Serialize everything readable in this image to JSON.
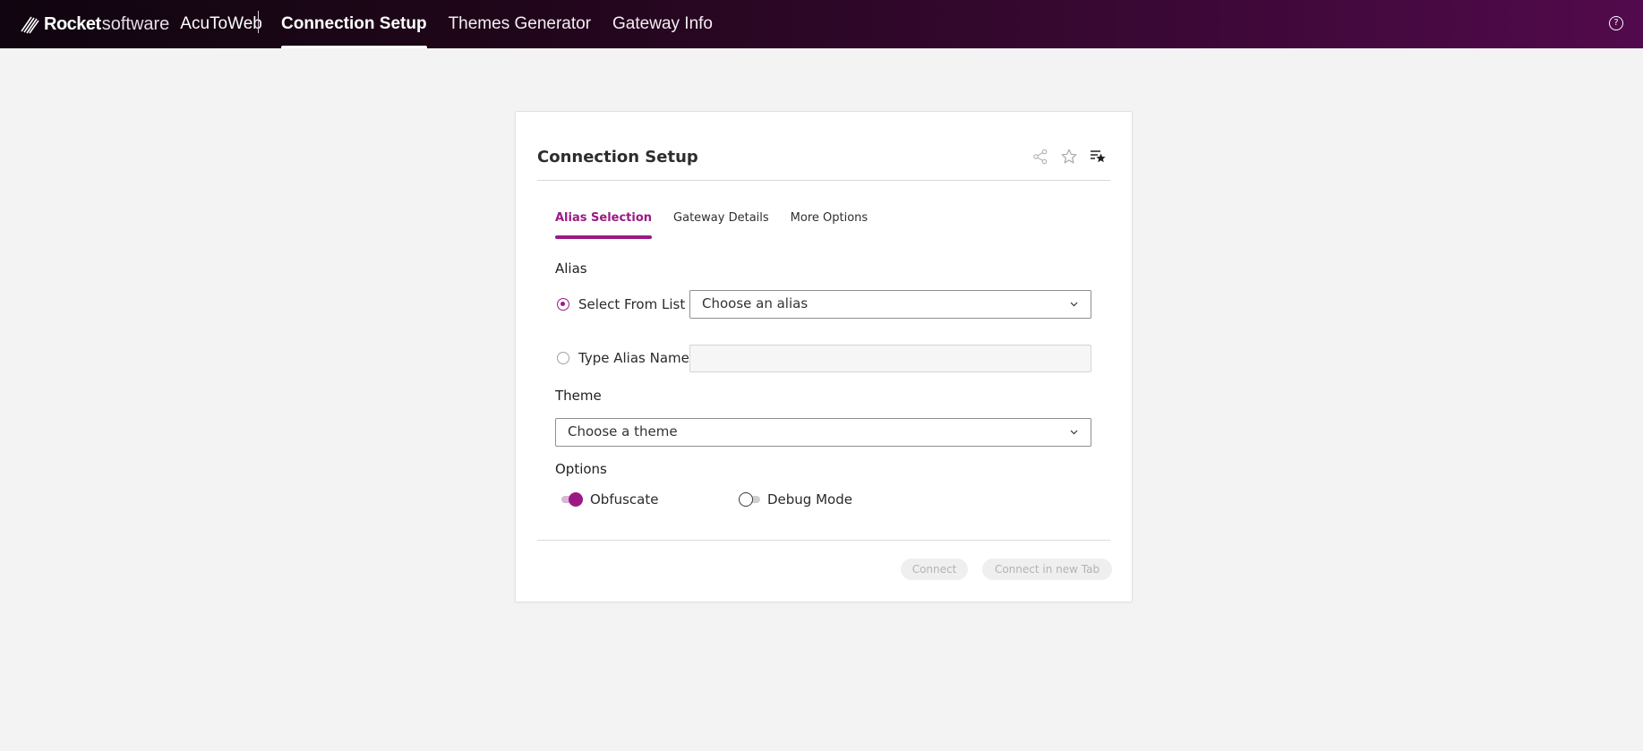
{
  "app": {
    "brand_rocket": "Rocket",
    "brand_software": "software",
    "product": "AcuToWeb"
  },
  "nav": {
    "tabs": [
      {
        "label": "Connection Setup",
        "active": true
      },
      {
        "label": "Themes Generator",
        "active": false
      },
      {
        "label": "Gateway Info",
        "active": false
      }
    ],
    "help_icon": "question-circle-icon"
  },
  "card": {
    "title": "Connection Setup",
    "header_icons": [
      "share-icon",
      "star-outline-icon",
      "favorites-list-icon"
    ],
    "tabs": [
      {
        "label": "Alias Selection",
        "active": true
      },
      {
        "label": "Gateway Details",
        "active": false
      },
      {
        "label": "More Options",
        "active": false
      }
    ],
    "alias": {
      "section_label": "Alias",
      "select_from_list": {
        "label": "Select From List",
        "selected": true,
        "placeholder": "Choose an alias"
      },
      "type_alias_name": {
        "label": "Type Alias Name",
        "selected": false,
        "value": ""
      }
    },
    "theme": {
      "section_label": "Theme",
      "placeholder": "Choose a theme"
    },
    "options": {
      "section_label": "Options",
      "obfuscate": {
        "label": "Obfuscate",
        "on": true
      },
      "debug_mode": {
        "label": "Debug Mode",
        "on": false
      }
    },
    "buttons": {
      "connect": "Connect",
      "connect_new_tab": "Connect in new Tab"
    }
  },
  "colors": {
    "accent": "#9a1a85",
    "topbar_start": "#100510",
    "topbar_end": "#520a4c",
    "page_bg": "#f3f3f3"
  }
}
